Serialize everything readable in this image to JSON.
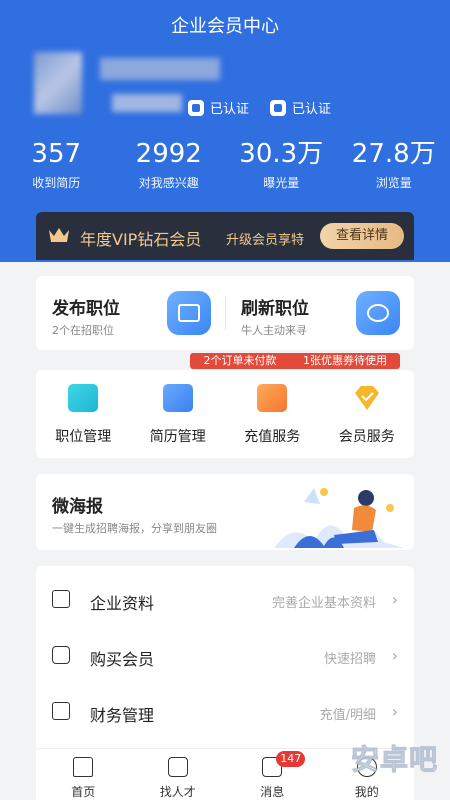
{
  "header": {
    "title": "企业会员中心",
    "cert1": "已认证",
    "cert2": "已认证",
    "accent": "#2f6fe0"
  },
  "stats": [
    {
      "num": "357",
      "label": "收到简历"
    },
    {
      "num": "2992",
      "label": "对我感兴趣"
    },
    {
      "num": "30.3万",
      "label": "曝光量"
    },
    {
      "num": "27.8万",
      "label": "浏览量"
    }
  ],
  "vip": {
    "title": "年度VIP钻石会员",
    "subtitle": "升级会员享特",
    "button": "查看详情",
    "icon": "crown-icon"
  },
  "job_actions": [
    {
      "title": "发布职位",
      "sub": "2个在招职位",
      "icon": "briefcase-icon"
    },
    {
      "title": "刷新职位",
      "sub": "牛人主动来寻",
      "icon": "refresh-icon"
    }
  ],
  "promos": {
    "orders": "2个订单未付款",
    "coupons": "1张优惠券待使用"
  },
  "services": [
    {
      "label": "职位管理",
      "icon": "folder-icon"
    },
    {
      "label": "简历管理",
      "icon": "resume-icon"
    },
    {
      "label": "充值服务",
      "icon": "wallet-icon"
    },
    {
      "label": "会员服务",
      "icon": "diamond-icon"
    }
  ],
  "poster": {
    "title": "微海报",
    "sub": "一键生成招聘海报，分享到朋友圈"
  },
  "menu": [
    {
      "label": "企业资料",
      "value": "完善企业基本资料",
      "icon": "document-icon"
    },
    {
      "label": "购买会员",
      "value": "快速招聘",
      "icon": "card-icon"
    },
    {
      "label": "财务管理",
      "value": "充值/明细",
      "icon": "finance-icon"
    }
  ],
  "tabs": [
    {
      "label": "首页",
      "icon": "home-icon"
    },
    {
      "label": "找人才",
      "icon": "talent-icon"
    },
    {
      "label": "消息",
      "icon": "message-icon",
      "badge": "147"
    },
    {
      "label": "我的",
      "icon": "profile-icon"
    }
  ],
  "watermark": "安卓吧"
}
